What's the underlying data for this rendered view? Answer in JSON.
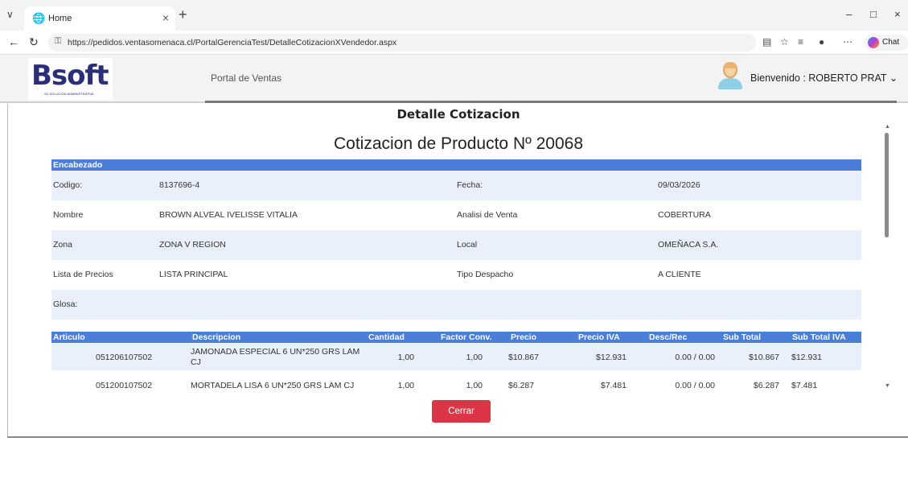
{
  "browser": {
    "tab_title": "Home",
    "url": "https://pedidos.ventasomenaca.cl/PortalGerenciaTest/DetalleCotizacionXVendedor.aspx",
    "chat_label": "Chat"
  },
  "header": {
    "logo_text": "Bsoft",
    "logo_tagline": "SU SOLUCION ADMINISTRATIVA",
    "portal_name": "Portal de Ventas",
    "welcome": "Bienvenido : ROBERTO PRAT"
  },
  "page": {
    "title": "Detalle Cotizacion",
    "doc_title": "Cotizacion de Producto Nº 20068",
    "section_header": "Encabezado",
    "close_button": "Cerrar"
  },
  "encabezado": [
    {
      "l1": "Codigo:",
      "v1": "8137696-4",
      "l2": "Fecha:",
      "v2": "09/03/2026"
    },
    {
      "l1": "Nombre",
      "v1": "BROWN ALVEAL IVELISSE VITALIA",
      "l2": "Analisi de Venta",
      "v2": "COBERTURA"
    },
    {
      "l1": "Zona",
      "v1": "ZONA V REGION",
      "l2": "Local",
      "v2": "OMEÑACA S.A."
    },
    {
      "l1": "Lista de Precios",
      "v1": "LISTA PRINCIPAL",
      "l2": "Tipo Despacho",
      "v2": "A CLIENTE"
    },
    {
      "l1": "Glosa:",
      "v1": "",
      "l2": "",
      "v2": ""
    }
  ],
  "table": {
    "columns": [
      "Articulo",
      "Descripcion",
      "Cantidad",
      "Factor Conv.",
      "Precio",
      "Precio IVA",
      "Desc/Rec",
      "Sub Total",
      "Sub Total IVA"
    ],
    "rows": [
      {
        "articulo": "051206107502",
        "descripcion": "JAMONADA ESPECIAL 6 UN*250 GRS LAM CJ",
        "cantidad": "1,00",
        "factor": "1,00",
        "precio": "$10.867",
        "precio_iva": "$12.931",
        "desc_rec": "0.00 / 0.00",
        "sub_total": "$10.867",
        "sub_total_iva": "$12.931"
      },
      {
        "articulo": "051200107502",
        "descripcion": "MORTADELA LISA 6 UN*250 GRS LAM CJ",
        "cantidad": "1,00",
        "factor": "1,00",
        "precio": "$6.287",
        "precio_iva": "$7.481",
        "desc_rec": "0.00 / 0.00",
        "sub_total": "$6.287",
        "sub_total_iva": "$7.481"
      }
    ]
  }
}
